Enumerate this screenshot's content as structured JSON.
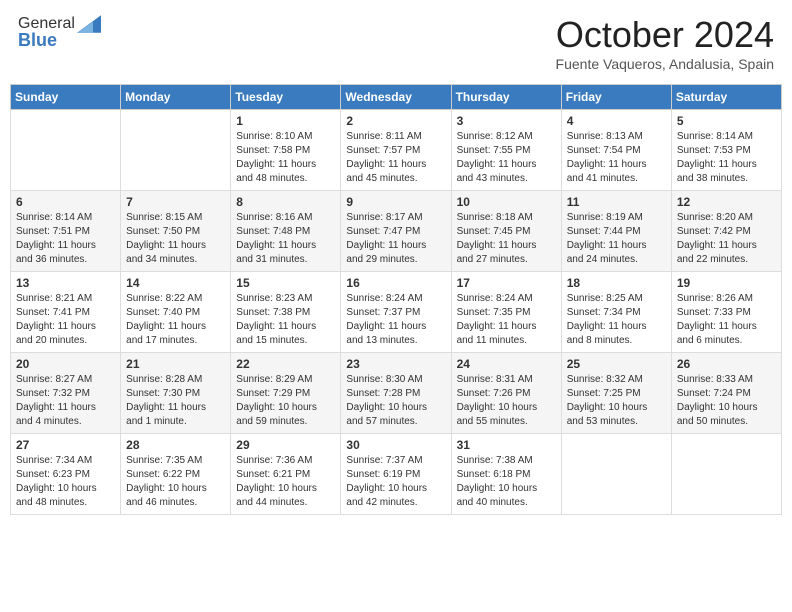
{
  "header": {
    "logo_line1": "General",
    "logo_line2": "Blue",
    "month_title": "October 2024",
    "subtitle": "Fuente Vaqueros, Andalusia, Spain"
  },
  "days_of_week": [
    "Sunday",
    "Monday",
    "Tuesday",
    "Wednesday",
    "Thursday",
    "Friday",
    "Saturday"
  ],
  "weeks": [
    [
      {
        "day": null,
        "info": null
      },
      {
        "day": null,
        "info": null
      },
      {
        "day": "1",
        "info": "Sunrise: 8:10 AM\nSunset: 7:58 PM\nDaylight: 11 hours and 48 minutes."
      },
      {
        "day": "2",
        "info": "Sunrise: 8:11 AM\nSunset: 7:57 PM\nDaylight: 11 hours and 45 minutes."
      },
      {
        "day": "3",
        "info": "Sunrise: 8:12 AM\nSunset: 7:55 PM\nDaylight: 11 hours and 43 minutes."
      },
      {
        "day": "4",
        "info": "Sunrise: 8:13 AM\nSunset: 7:54 PM\nDaylight: 11 hours and 41 minutes."
      },
      {
        "day": "5",
        "info": "Sunrise: 8:14 AM\nSunset: 7:53 PM\nDaylight: 11 hours and 38 minutes."
      }
    ],
    [
      {
        "day": "6",
        "info": "Sunrise: 8:14 AM\nSunset: 7:51 PM\nDaylight: 11 hours and 36 minutes."
      },
      {
        "day": "7",
        "info": "Sunrise: 8:15 AM\nSunset: 7:50 PM\nDaylight: 11 hours and 34 minutes."
      },
      {
        "day": "8",
        "info": "Sunrise: 8:16 AM\nSunset: 7:48 PM\nDaylight: 11 hours and 31 minutes."
      },
      {
        "day": "9",
        "info": "Sunrise: 8:17 AM\nSunset: 7:47 PM\nDaylight: 11 hours and 29 minutes."
      },
      {
        "day": "10",
        "info": "Sunrise: 8:18 AM\nSunset: 7:45 PM\nDaylight: 11 hours and 27 minutes."
      },
      {
        "day": "11",
        "info": "Sunrise: 8:19 AM\nSunset: 7:44 PM\nDaylight: 11 hours and 24 minutes."
      },
      {
        "day": "12",
        "info": "Sunrise: 8:20 AM\nSunset: 7:42 PM\nDaylight: 11 hours and 22 minutes."
      }
    ],
    [
      {
        "day": "13",
        "info": "Sunrise: 8:21 AM\nSunset: 7:41 PM\nDaylight: 11 hours and 20 minutes."
      },
      {
        "day": "14",
        "info": "Sunrise: 8:22 AM\nSunset: 7:40 PM\nDaylight: 11 hours and 17 minutes."
      },
      {
        "day": "15",
        "info": "Sunrise: 8:23 AM\nSunset: 7:38 PM\nDaylight: 11 hours and 15 minutes."
      },
      {
        "day": "16",
        "info": "Sunrise: 8:24 AM\nSunset: 7:37 PM\nDaylight: 11 hours and 13 minutes."
      },
      {
        "day": "17",
        "info": "Sunrise: 8:24 AM\nSunset: 7:35 PM\nDaylight: 11 hours and 11 minutes."
      },
      {
        "day": "18",
        "info": "Sunrise: 8:25 AM\nSunset: 7:34 PM\nDaylight: 11 hours and 8 minutes."
      },
      {
        "day": "19",
        "info": "Sunrise: 8:26 AM\nSunset: 7:33 PM\nDaylight: 11 hours and 6 minutes."
      }
    ],
    [
      {
        "day": "20",
        "info": "Sunrise: 8:27 AM\nSunset: 7:32 PM\nDaylight: 11 hours and 4 minutes."
      },
      {
        "day": "21",
        "info": "Sunrise: 8:28 AM\nSunset: 7:30 PM\nDaylight: 11 hours and 1 minute."
      },
      {
        "day": "22",
        "info": "Sunrise: 8:29 AM\nSunset: 7:29 PM\nDaylight: 10 hours and 59 minutes."
      },
      {
        "day": "23",
        "info": "Sunrise: 8:30 AM\nSunset: 7:28 PM\nDaylight: 10 hours and 57 minutes."
      },
      {
        "day": "24",
        "info": "Sunrise: 8:31 AM\nSunset: 7:26 PM\nDaylight: 10 hours and 55 minutes."
      },
      {
        "day": "25",
        "info": "Sunrise: 8:32 AM\nSunset: 7:25 PM\nDaylight: 10 hours and 53 minutes."
      },
      {
        "day": "26",
        "info": "Sunrise: 8:33 AM\nSunset: 7:24 PM\nDaylight: 10 hours and 50 minutes."
      }
    ],
    [
      {
        "day": "27",
        "info": "Sunrise: 7:34 AM\nSunset: 6:23 PM\nDaylight: 10 hours and 48 minutes."
      },
      {
        "day": "28",
        "info": "Sunrise: 7:35 AM\nSunset: 6:22 PM\nDaylight: 10 hours and 46 minutes."
      },
      {
        "day": "29",
        "info": "Sunrise: 7:36 AM\nSunset: 6:21 PM\nDaylight: 10 hours and 44 minutes."
      },
      {
        "day": "30",
        "info": "Sunrise: 7:37 AM\nSunset: 6:19 PM\nDaylight: 10 hours and 42 minutes."
      },
      {
        "day": "31",
        "info": "Sunrise: 7:38 AM\nSunset: 6:18 PM\nDaylight: 10 hours and 40 minutes."
      },
      {
        "day": null,
        "info": null
      },
      {
        "day": null,
        "info": null
      }
    ]
  ]
}
